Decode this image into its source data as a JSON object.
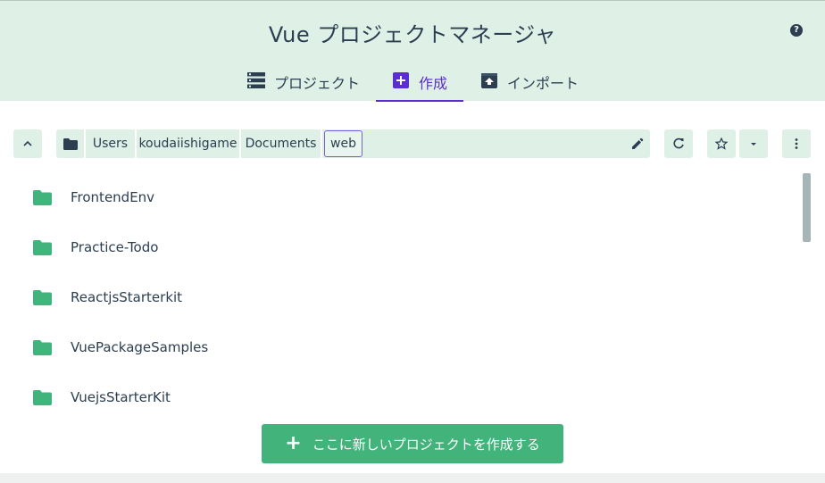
{
  "header": {
    "title": "Vue プロジェクトマネージャ",
    "help_glyph": "?"
  },
  "tabs": [
    {
      "label": "プロジェクト",
      "icon": "list-icon",
      "active": false
    },
    {
      "label": "作成",
      "icon": "add-box-icon",
      "active": true
    },
    {
      "label": "インポート",
      "icon": "unarchive-icon",
      "active": false
    }
  ],
  "path": {
    "crumbs": [
      "Users",
      "koudaiishigame",
      "Documents",
      "web"
    ],
    "current": "web"
  },
  "folders": [
    {
      "name": "FrontendEnv"
    },
    {
      "name": "Practice-Todo"
    },
    {
      "name": "ReactjsStarterkit"
    },
    {
      "name": "VuePackageSamples"
    },
    {
      "name": "VuejsStarterKit"
    }
  ],
  "actions": {
    "create_here_label": "ここに新しいプロジェクトを作成する",
    "create_plus_glyph": "+"
  },
  "colors": {
    "header_bg": "#dff1e7",
    "accent": "#5b2ecf",
    "folder": "#42b37a",
    "button": "#42b37a",
    "text": "#2c3e50"
  }
}
